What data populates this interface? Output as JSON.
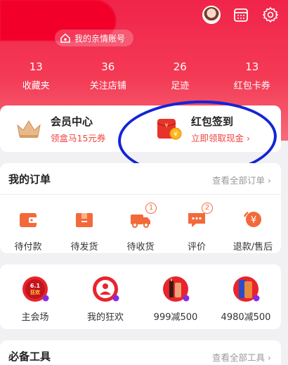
{
  "header": {
    "family_account_label": "我的亲情账号"
  },
  "stats": [
    {
      "num": "13",
      "label": "收藏夹"
    },
    {
      "num": "36",
      "label": "关注店铺"
    },
    {
      "num": "26",
      "label": "足迹"
    },
    {
      "num": "13",
      "label": "红包卡券"
    }
  ],
  "member": {
    "left_title": "会员中心",
    "left_sub": "领盒马15元券",
    "right_title": "红包签到",
    "right_sub": "立即领取现金 ›"
  },
  "orders": {
    "title": "我的订单",
    "more": "查看全部订单 ›",
    "items": [
      {
        "label": "待付款",
        "badge": ""
      },
      {
        "label": "待发货",
        "badge": ""
      },
      {
        "label": "待收货",
        "badge": "1"
      },
      {
        "label": "评价",
        "badge": "2"
      },
      {
        "label": "退款/售后",
        "badge": ""
      }
    ]
  },
  "carnival": {
    "items": [
      {
        "label": "主会场",
        "icon_text": "6.1狂欢"
      },
      {
        "label": "我的狂欢"
      },
      {
        "label": "999减500"
      },
      {
        "label": "4980减500"
      }
    ]
  },
  "tools": {
    "title": "必备工具",
    "more": "查看全部工具 ›"
  },
  "colors": {
    "header_red": "#f0244a",
    "accent_orange": "#f26a3a",
    "annotation_blue": "#1424d6"
  }
}
